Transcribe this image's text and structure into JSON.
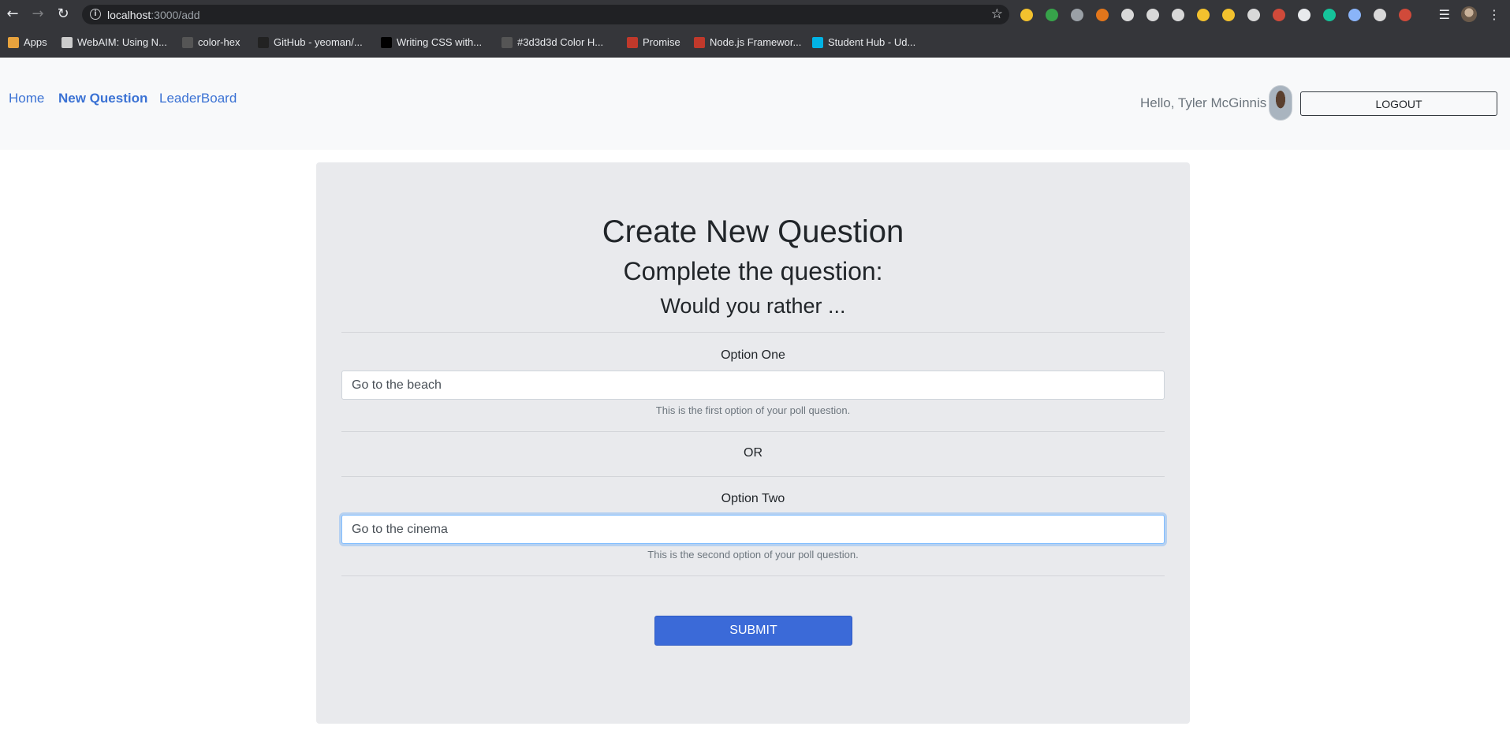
{
  "browser": {
    "url_host": "localhost",
    "url_path": ":3000/add",
    "bookmarks": [
      {
        "label": "Apps",
        "icon": "apps-grid-icon",
        "color": "#e8a33d"
      },
      {
        "label": "WebAIM: Using N...",
        "icon": "gear-icon",
        "color": "#cccccc"
      },
      {
        "label": "color-hex",
        "icon": "color-hex-icon",
        "color": "#555555"
      },
      {
        "label": "GitHub - yeoman/...",
        "icon": "github-icon",
        "color": "#222222"
      },
      {
        "label": "Writing CSS with...",
        "icon": "medium-icon",
        "color": "#000000"
      },
      {
        "label": "#3d3d3d Color H...",
        "icon": "color-hex-icon",
        "color": "#555555"
      },
      {
        "label": "Promise",
        "icon": "promise-icon",
        "color": "#c0392b"
      },
      {
        "label": "Node.js Framewor...",
        "icon": "pinterest-icon",
        "color": "#c0392b"
      },
      {
        "label": "Student Hub - Ud...",
        "icon": "udacity-icon",
        "color": "#02b3e4"
      }
    ],
    "extensions": [
      {
        "name": "magnifier-icon",
        "color": "#f2c12e"
      },
      {
        "name": "check-icon",
        "color": "#37a34a"
      },
      {
        "name": "github-ext-icon",
        "color": "#9aa0a6"
      },
      {
        "name": "fox-icon",
        "color": "#e2761b"
      },
      {
        "name": "pdf-icon",
        "color": "#d8d8d8"
      },
      {
        "name": "search-ext-icon",
        "color": "#d8d8d8"
      },
      {
        "name": "search-ext-icon",
        "color": "#d8d8d8"
      },
      {
        "name": "magnifier-yellow-icon",
        "color": "#f2c12e"
      },
      {
        "name": "home-icon",
        "color": "#f2c12e"
      },
      {
        "name": "record-icon",
        "color": "#d8d8d8"
      },
      {
        "name": "shield-icon",
        "color": "#d04a3a"
      },
      {
        "name": "contrast-icon",
        "color": "#e8eaed"
      },
      {
        "name": "grammarly-icon",
        "color": "#15c39a"
      },
      {
        "name": "ring-icon",
        "color": "#8ab4f8"
      },
      {
        "name": "mortarboard-icon",
        "color": "#d8d8d8"
      },
      {
        "name": "redux-icon",
        "color": "#d04a3a"
      }
    ]
  },
  "header": {
    "nav": [
      {
        "label": "Home",
        "active": false
      },
      {
        "label": "New Question",
        "active": true
      },
      {
        "label": "LeaderBoard",
        "active": false
      }
    ],
    "greeting": "Hello, Tyler McGinnis",
    "logout_label": "Logout"
  },
  "form": {
    "title": "Create New Question",
    "subtitle": "Complete the question:",
    "prompt": "Would you rather ...",
    "option_one": {
      "label": "Option One",
      "value": "Go to the beach",
      "help": "This is the first option of your poll question."
    },
    "or_label": "OR",
    "option_two": {
      "label": "Option Two",
      "value": "Go to the cinema",
      "help": "This is the second option of your poll question."
    },
    "submit_label": "Submit"
  },
  "colors": {
    "accent": "#3b6ad8",
    "link": "#3b72d4",
    "card_bg": "#e9eaed",
    "header_bg": "#f8f9fa"
  }
}
